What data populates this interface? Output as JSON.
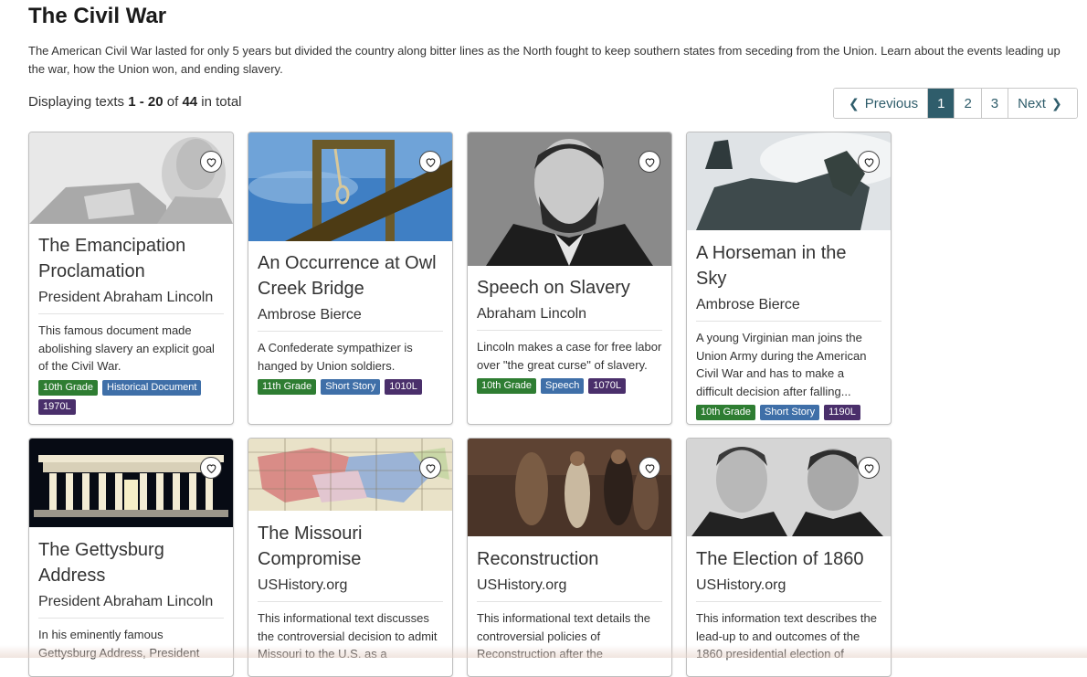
{
  "page": {
    "title": "The Civil War",
    "description": "The American Civil War lasted for only 5 years but divided the country along bitter lines as the North fought to keep southern states from seceding from the Union. Learn about the events leading up the war, how the Union won, and ending slavery.",
    "count_prefix": "Displaying texts",
    "count_range": "1 - 20",
    "count_of": "of",
    "count_total": "44",
    "count_suffix": "in total"
  },
  "pagination": {
    "previous": "Previous",
    "pages": [
      "1",
      "2",
      "3"
    ],
    "active": "1",
    "next": "Next"
  },
  "cards": [
    {
      "title": "The Emancipation Proclamation",
      "author": "President Abraham Lincoln",
      "summary": "This famous document made abolishing slavery an explicit goal of the Civil War.",
      "grade": "10th Grade",
      "genre": "Historical Document",
      "lexile": "1970L"
    },
    {
      "title": "An Occurrence at Owl Creek Bridge",
      "author": "Ambrose Bierce",
      "summary": "A Confederate sympathizer is hanged by Union soldiers.",
      "grade": "11th Grade",
      "genre": "Short Story",
      "lexile": "1010L"
    },
    {
      "title": "Speech on Slavery",
      "author": "Abraham Lincoln",
      "summary": "Lincoln makes a case for free labor over \"the great curse\" of slavery.",
      "grade": "10th Grade",
      "genre": "Speech",
      "lexile": "1070L"
    },
    {
      "title": "A Horseman in the Sky",
      "author": "Ambrose Bierce",
      "summary": "A young Virginian man joins the Union Army during the American Civil War and has to make a difficult decision after falling...",
      "grade": "10th Grade",
      "genre": "Short Story",
      "lexile": "1190L"
    },
    {
      "title": "The Gettysburg Address",
      "author": "President Abraham Lincoln",
      "summary": "In his eminently famous Gettysburg Address, President"
    },
    {
      "title": "The Missouri Compromise",
      "author": "USHistory.org",
      "summary": "This informational text discusses the controversial decision to admit Missouri to the U.S. as a"
    },
    {
      "title": "Reconstruction",
      "author": "USHistory.org",
      "summary": "This informational text details the controversial policies of Reconstruction after the"
    },
    {
      "title": "The Election of 1860",
      "author": "USHistory.org",
      "summary": "This information text describes the lead-up to and outcomes of the 1860 presidential election of"
    }
  ]
}
